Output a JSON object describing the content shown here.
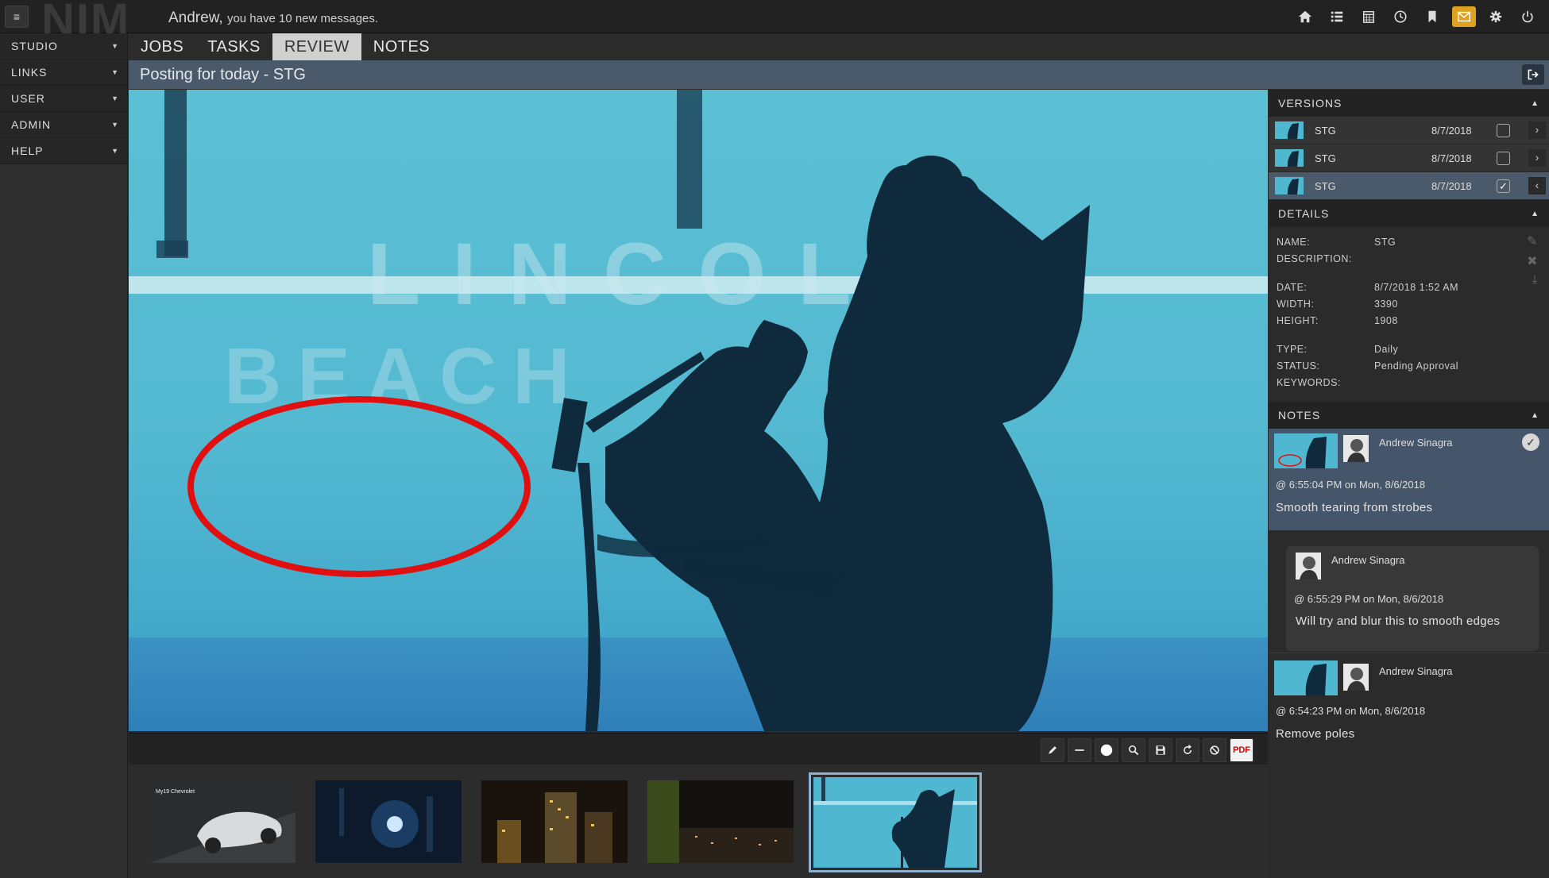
{
  "header": {
    "logo_text": "NIM",
    "user_name": "Andrew,",
    "welcome_rest": "you have 10 new messages.",
    "icons": [
      "home-icon",
      "list-icon",
      "calendar-icon",
      "clock-icon",
      "bookmark-icon",
      "mail-icon",
      "gear-icon",
      "power-icon"
    ]
  },
  "sidebar": {
    "items": [
      {
        "label": "STUDIO"
      },
      {
        "label": "LINKS"
      },
      {
        "label": "USER"
      },
      {
        "label": "ADMIN"
      },
      {
        "label": "HELP"
      }
    ]
  },
  "tabs": [
    {
      "label": "JOBS"
    },
    {
      "label": "TASKS"
    },
    {
      "label": "REVIEW",
      "active": true
    },
    {
      "label": "NOTES"
    }
  ],
  "posting": {
    "title": "Posting for today - STG"
  },
  "viewer": {
    "background_text_1": "LINCOL",
    "background_text_2": "BEACH"
  },
  "toolbar": {
    "tools": [
      "pencil-icon",
      "line-icon",
      "circle-icon",
      "zoom-icon",
      "save-icon",
      "reset-icon",
      "clear-icon",
      "pdf-icon"
    ],
    "pdf_label": "PDF"
  },
  "filmstrip": {
    "thumbs": [
      {
        "name": "thumb-car",
        "caption": "My19 Chevrolet"
      },
      {
        "name": "thumb-stage-light",
        "caption": ""
      },
      {
        "name": "thumb-city-night",
        "caption": ""
      },
      {
        "name": "thumb-city-skyline",
        "caption": ""
      },
      {
        "name": "thumb-singer",
        "caption": "",
        "selected": true
      }
    ]
  },
  "versions": {
    "header": "VERSIONS",
    "rows": [
      {
        "name": "STG",
        "date": "8/7/2018",
        "checked": false,
        "arrow": "›"
      },
      {
        "name": "STG",
        "date": "8/7/2018",
        "checked": false,
        "arrow": "›"
      },
      {
        "name": "STG",
        "date": "8/7/2018",
        "checked": true,
        "arrow": "‹"
      }
    ]
  },
  "details": {
    "header": "DETAILS",
    "name_label": "NAME:",
    "name_value": "STG",
    "description_label": "DESCRIPTION:",
    "description_value": "",
    "date_label": "DATE:",
    "date_value": "8/7/2018 1:52 AM",
    "width_label": "WIDTH:",
    "width_value": "3390",
    "height_label": "HEIGHT:",
    "height_value": "1908",
    "type_label": "TYPE:",
    "type_value": "Daily",
    "status_label": "STATUS:",
    "status_value": "Pending Approval",
    "keywords_label": "KEYWORDS:",
    "keywords_value": ""
  },
  "notes": {
    "header": "NOTES",
    "items": [
      {
        "author": "Andrew Sinagra",
        "time": "@ 6:55:04 PM on Mon, 8/6/2018",
        "text": "Smooth tearing from strobes"
      },
      {
        "author": "Andrew Sinagra",
        "time": "@ 6:55:29 PM on Mon, 8/6/2018",
        "text": "Will try and blur this to smooth edges"
      },
      {
        "author": "Andrew Sinagra",
        "time": "@ 6:54:23 PM on Mon, 8/6/2018",
        "text": "Remove poles"
      }
    ]
  },
  "colors": {
    "accent": "#e0a020",
    "selected_row": "#4a5a6a",
    "annotation": "#e01010",
    "sky": "#4fb7cf"
  }
}
